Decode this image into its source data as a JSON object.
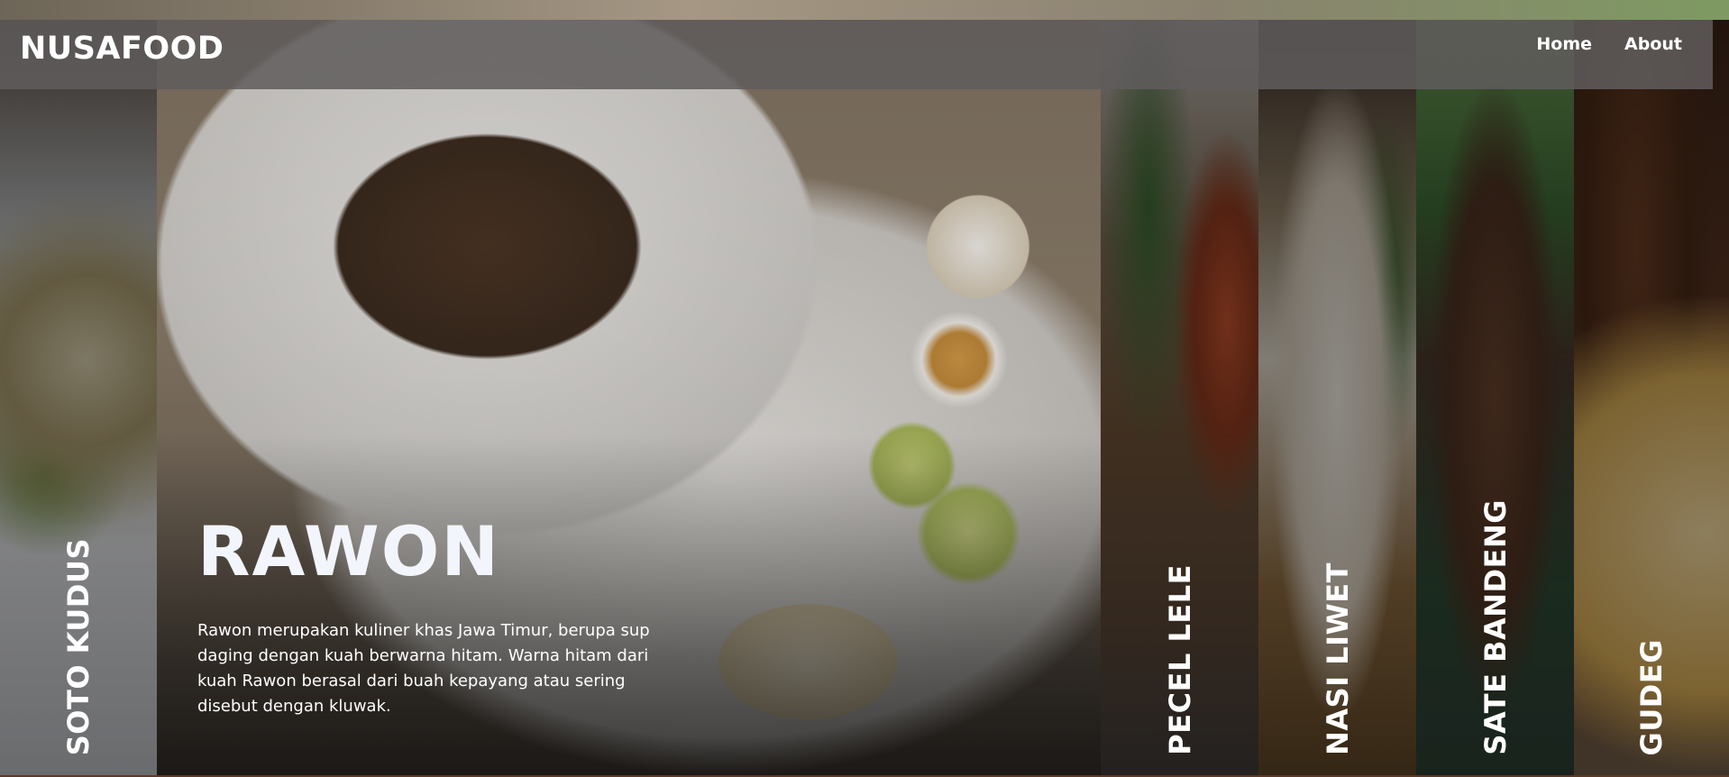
{
  "brand": "NUSAFOOD",
  "nav": [
    {
      "label": "Home"
    },
    {
      "label": "About"
    }
  ],
  "hero": {
    "title": "RAWON",
    "description": "Rawon merupakan kuliner khas Jawa Timur, berupa sup daging dengan kuah berwarna hitam. Warna hitam dari kuah Rawon berasal dari buah kepayang atau sering disebut dengan kluwak."
  },
  "panels": [
    {
      "label": "SOTO KUDUS"
    },
    {
      "label": "RAWON",
      "active": true
    },
    {
      "label": "PECEL LELE"
    },
    {
      "label": "NASI LIWET"
    },
    {
      "label": "SATE BANDENG"
    },
    {
      "label": "GUDEG"
    }
  ],
  "colors": {
    "navbar": "#5f5c5c",
    "text": "#ffffff",
    "hero_title": "#f2f5fb"
  }
}
